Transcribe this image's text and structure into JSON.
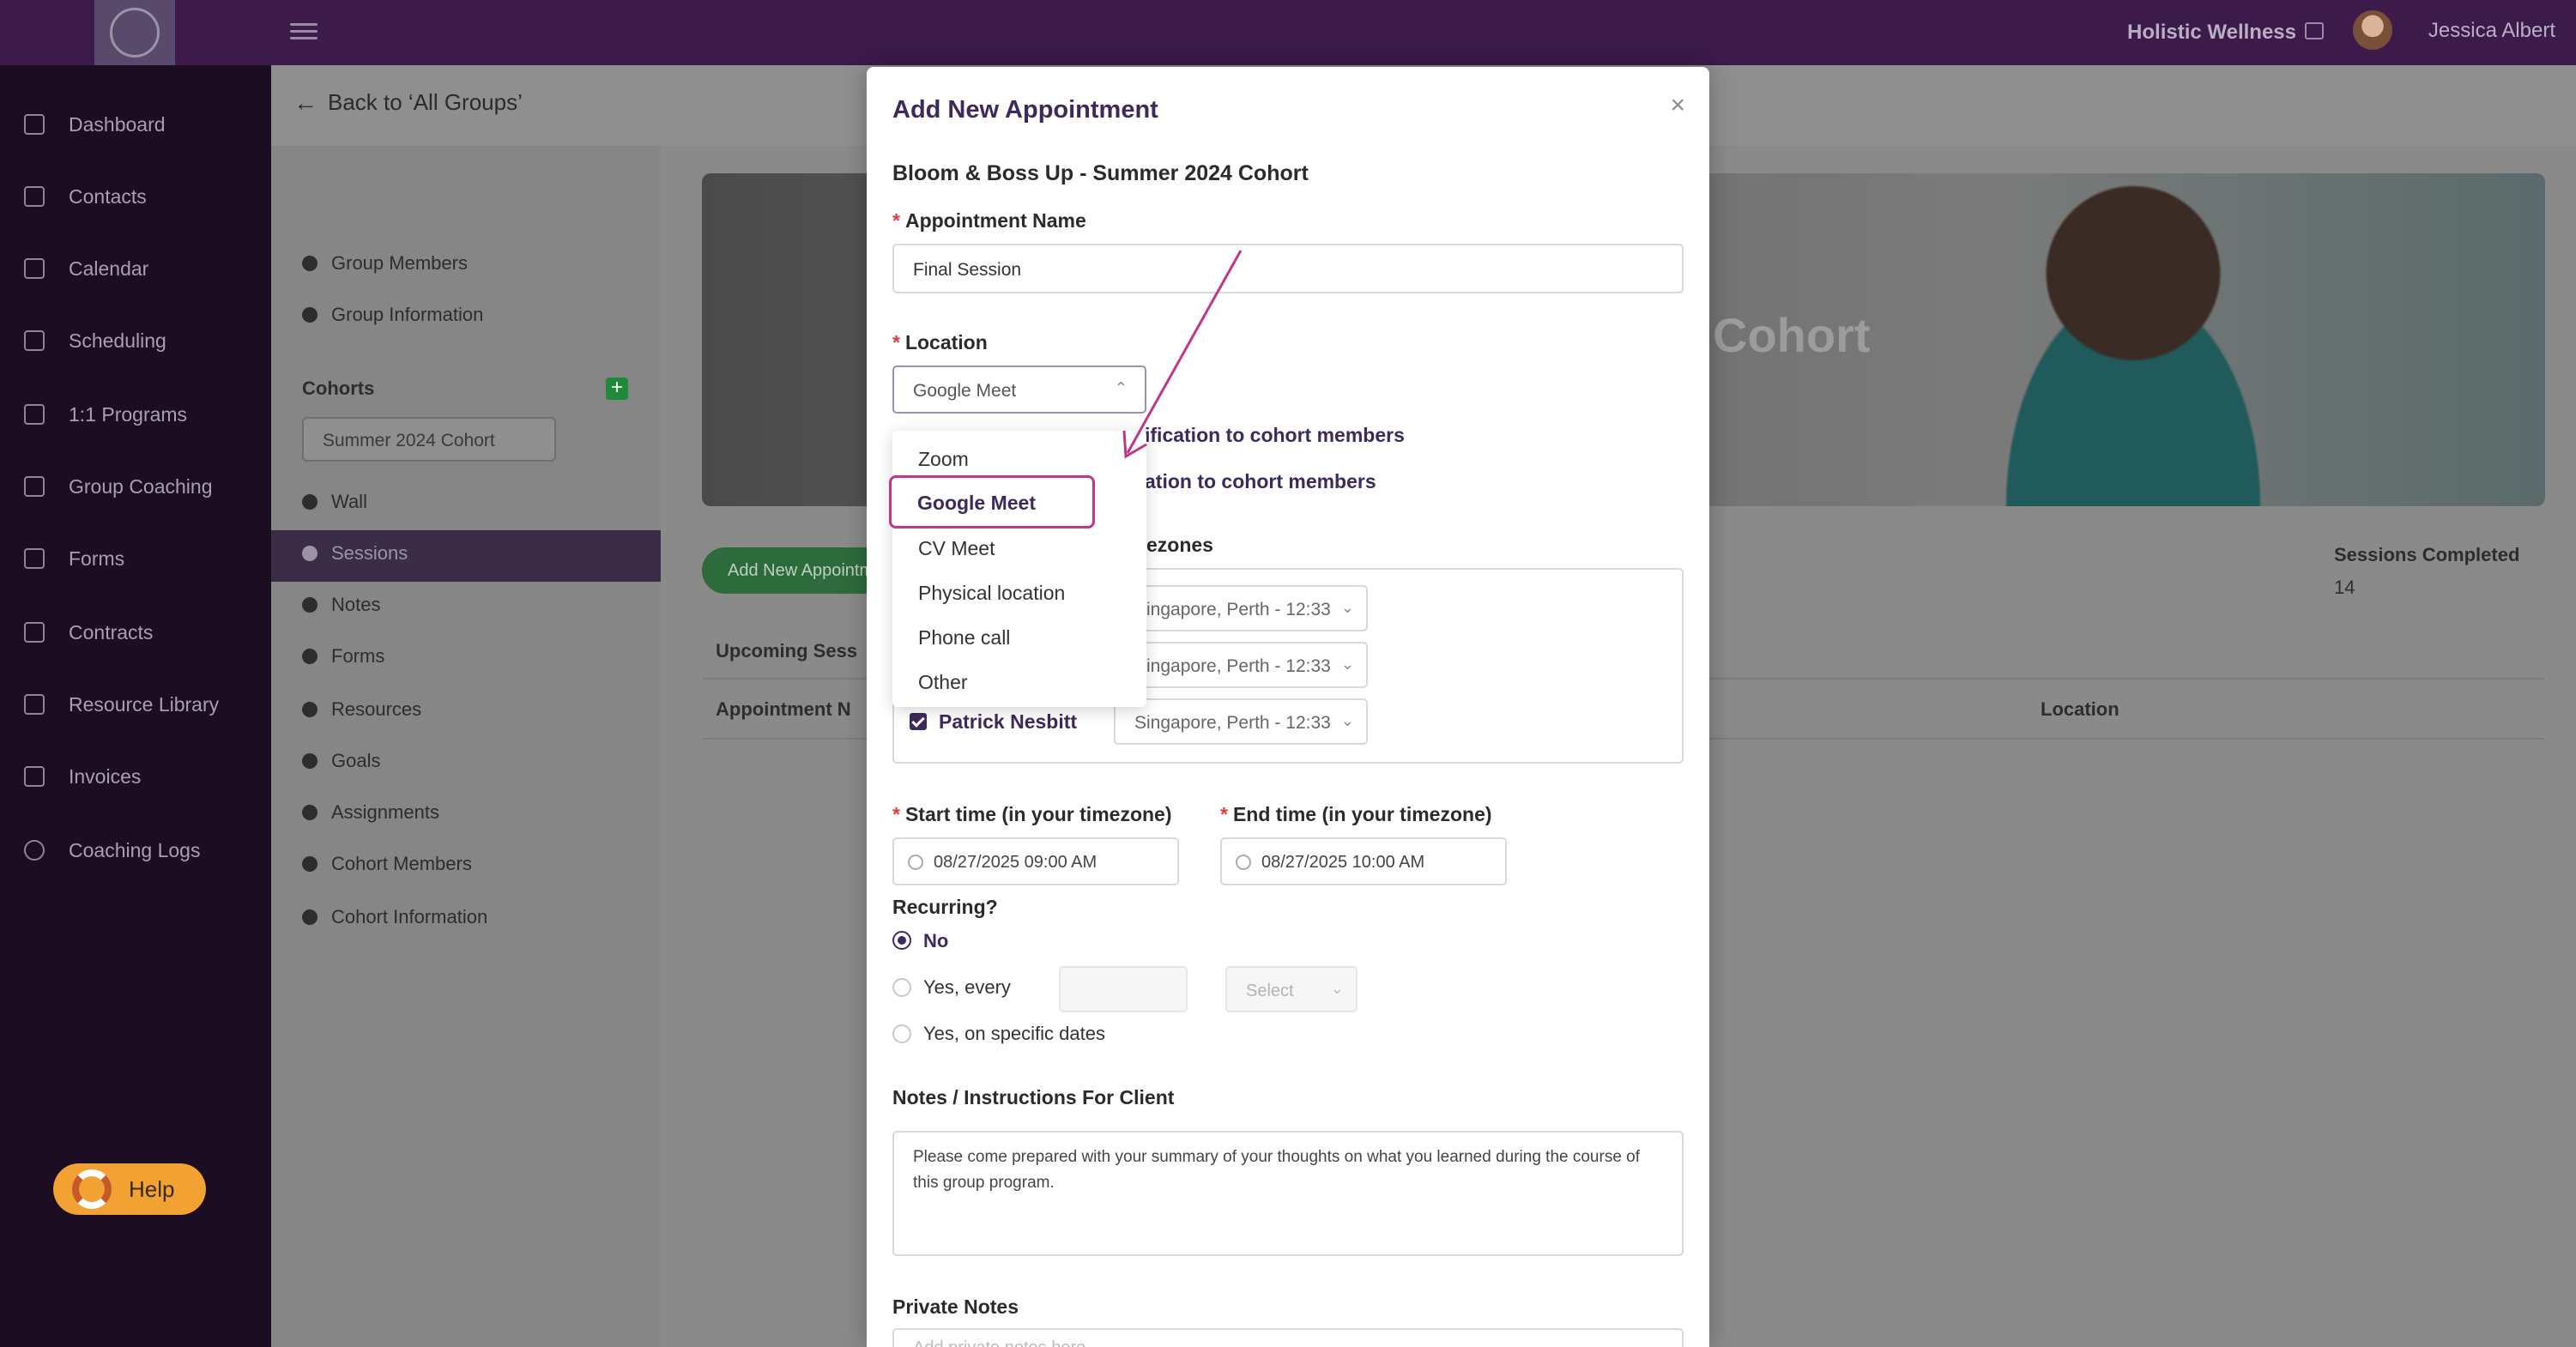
{
  "topbar": {
    "brand": "Holistic Wellness",
    "user": "Jessica Albert"
  },
  "leftnav": {
    "items": [
      {
        "label": "Dashboard",
        "icon": "dashboard-icon"
      },
      {
        "label": "Contacts",
        "icon": "contacts-icon"
      },
      {
        "label": "Calendar",
        "icon": "calendar-icon"
      },
      {
        "label": "Scheduling",
        "icon": "scheduling-icon"
      },
      {
        "label": "1:1 Programs",
        "icon": "programs-icon"
      },
      {
        "label": "Group Coaching",
        "icon": "group-icon"
      },
      {
        "label": "Forms",
        "icon": "forms-icon"
      },
      {
        "label": "Contracts",
        "icon": "contracts-icon"
      },
      {
        "label": "Resource Library",
        "icon": "library-icon"
      },
      {
        "label": "Invoices",
        "icon": "invoices-icon"
      },
      {
        "label": "Coaching Logs",
        "icon": "clock-icon"
      }
    ],
    "help_label": "Help"
  },
  "content": {
    "back_label": "Back to ‘All Groups’",
    "subnav": {
      "top_items": [
        "Group Members",
        "Group Information"
      ],
      "cohorts_title": "Cohorts",
      "cohort_selected": "Summer 2024 Cohort",
      "items": [
        "Wall",
        "Sessions",
        "Notes",
        "Forms",
        "Resources",
        "Goals",
        "Assignments",
        "Cohort Members",
        "Cohort Information"
      ]
    },
    "hero_title": "Cohort",
    "add_session_label": "Add New Appointment",
    "sessions_completed_label": "Sessions Completed",
    "sessions_completed_value": "14",
    "upcoming_title": "Upcoming Sess",
    "col_appointment": "Appointment N",
    "col_location": "Location"
  },
  "modal": {
    "title": "Add New Appointment",
    "cohort_name": "Bloom & Boss Up - Summer 2024 Cohort",
    "appointment_name_label": "Appointment Name",
    "appointment_name_value": "Final Session",
    "location_label": "Location",
    "location_value": "Google Meet",
    "notification_1": "ification to cohort members",
    "notification_2": "ation to cohort members",
    "timezones_title": "ezones",
    "members": [
      {
        "name": "",
        "timezone": "Singapore, Perth - 12:33"
      },
      {
        "name": "",
        "timezone": "Singapore, Perth - 12:33"
      },
      {
        "name": "Patrick Nesbitt",
        "timezone": "Singapore, Perth - 12:33"
      }
    ],
    "start_label": "Start time (in your timezone)",
    "start_value": "08/27/2025 09:00 AM",
    "end_label": "End time (in your timezone)",
    "end_value": "08/27/2025 10:00 AM",
    "recurring_label": "Recurring?",
    "recurring_no": "No",
    "recurring_yes_every": "Yes, every",
    "recurring_select_placeholder": "Select",
    "recurring_specific": "Yes, on specific dates",
    "notes_label": "Notes / Instructions For Client",
    "notes_value": "Please come prepared with your summary of your thoughts on what you learned during the course of this group program.",
    "private_notes_label": "Private Notes",
    "private_notes_placeholder": "Add private notes here"
  },
  "location_dropdown": {
    "options": [
      "Zoom",
      "Google Meet",
      "CV Meet",
      "Physical location",
      "Phone call",
      "Other"
    ],
    "selected": "Google Meet"
  },
  "colors": {
    "topbar": "#3c1a4a",
    "nav": "#1c0d23",
    "accent": "#3d2a5c",
    "highlight": "#c0378a",
    "help": "#f2a233"
  }
}
